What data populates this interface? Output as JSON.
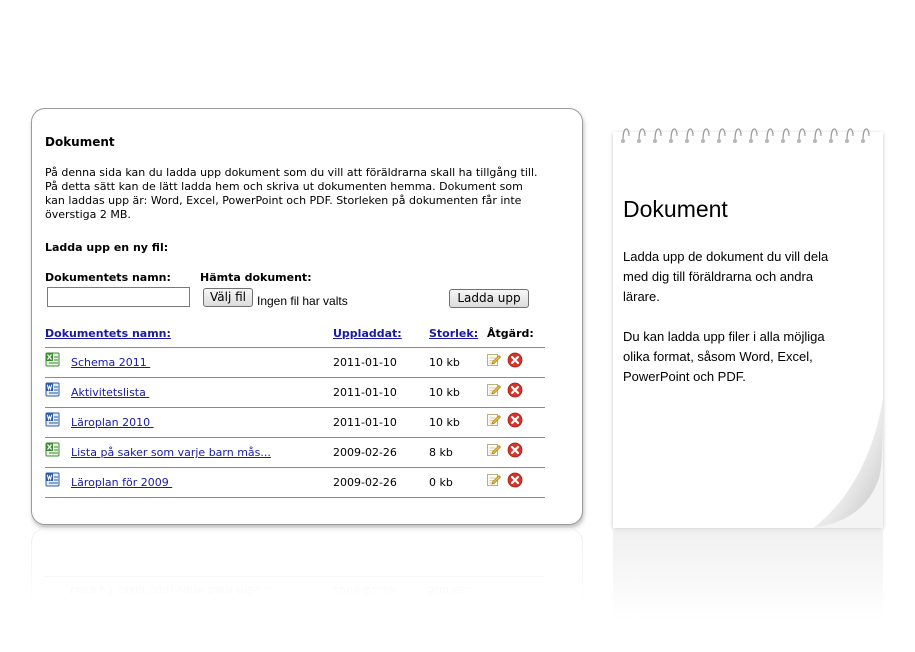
{
  "page": {
    "title": "Dokument",
    "intro": "På denna sida kan du ladda upp dokument som du vill att föräldrarna skall ha tillgång till. På detta sätt kan de lätt ladda hem och skriva ut dokumenten hemma. Dokument som kan laddas upp är: Word, Excel, PowerPoint och PDF. Storleken på dokumenten får inte överstiga 2 MB."
  },
  "upload": {
    "heading": "Ladda upp en ny fil:",
    "name_label": "Dokumentets namn:",
    "name_value": "",
    "fetch_label": "Hämta dokument:",
    "choose_button": "Välj fil",
    "no_file_text": "Ingen fil har valts",
    "upload_button": "Ladda upp"
  },
  "table": {
    "headers": {
      "name": "Dokumentets namn:",
      "uploaded": "Uppladdat:",
      "size": "Storlek:",
      "action": "Åtgärd:"
    },
    "rows": [
      {
        "icon": "excel-file-icon",
        "name": "Schema 2011 ",
        "date": "2011-01-10",
        "size": "10 kb"
      },
      {
        "icon": "word-file-icon",
        "name": "Aktivitetslista ",
        "date": "2011-01-10",
        "size": "10 kb"
      },
      {
        "icon": "word-file-icon",
        "name": "Läroplan 2010 ",
        "date": "2011-01-10",
        "size": "10 kb"
      },
      {
        "icon": "excel-file-icon",
        "name": "Lista på saker som varje barn mås...",
        "date": "2009-02-26",
        "size": "8 kb"
      },
      {
        "icon": "word-file-icon",
        "name": "Läroplan för 2009 ",
        "date": "2009-02-26",
        "size": "0 kb"
      }
    ]
  },
  "notepad": {
    "title": "Dokument",
    "paragraph1": "Ladda upp de dokument du vill dela med dig till föräldrarna och andra lärare.",
    "paragraph2": "Du kan ladda upp filer i alla möjliga olika format, såsom Word, Excel, PowerPoint och PDF."
  },
  "colors": {
    "link": "#1a1aa6",
    "excel_green": "#3a8a2e",
    "word_blue": "#2b5aa8",
    "delete_red": "#d9342b"
  }
}
